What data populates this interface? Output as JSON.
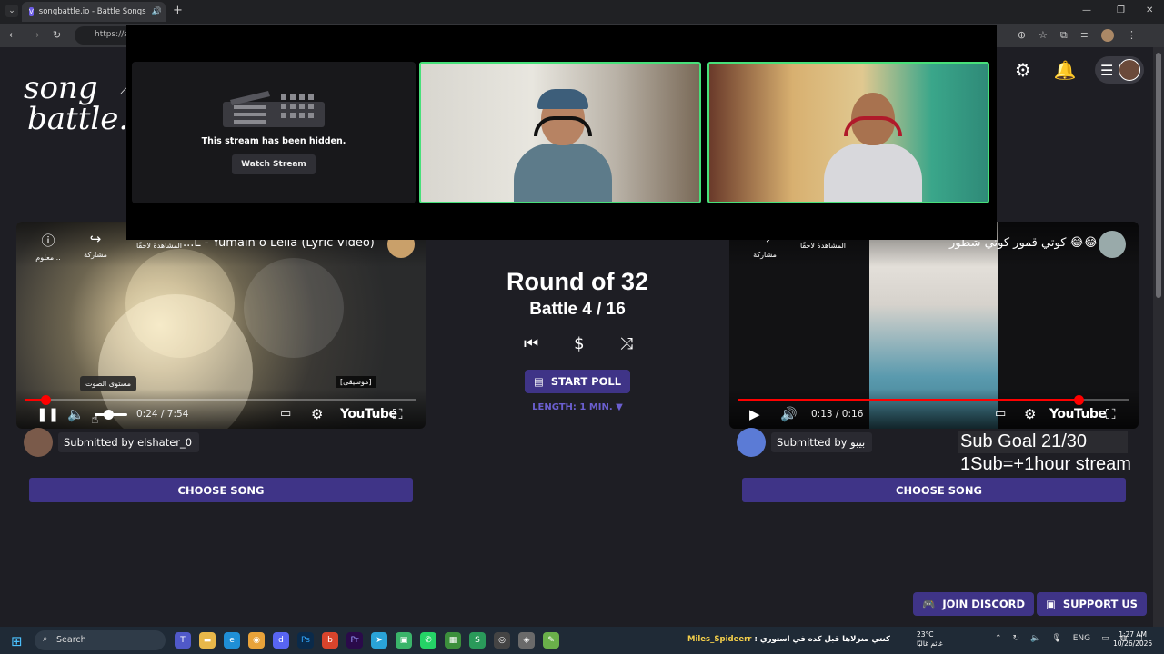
{
  "browser": {
    "tab_title": "songbattle.io - Battle Songs",
    "url": "https://s",
    "tab_favicon": "V"
  },
  "site": {
    "logo_line1": "song",
    "logo_line2": "battle.i"
  },
  "overlay": {
    "hidden_text": "This stream has been hidden.",
    "watch_button": "Watch Stream"
  },
  "left_player": {
    "title": "...L - Yumain o Leila (Lyric Video)",
    "info_label": "معلوم...",
    "share_label": "مشاركة",
    "watch_later_label": "المشاهدة لاحقًا",
    "tooltip": "مستوى الصوت",
    "music_tag": "[موسيقى]",
    "time": "0:24 / 7:54",
    "progress": 0.05,
    "youtube_label": "YouTube"
  },
  "right_player": {
    "title": "كوتي قمور كوتي شطور 😂😂",
    "share_label": "مشاركة",
    "watch_later_label": "المشاهدة لاحقًا",
    "time": "0:13 / 0:16",
    "progress": 0.87,
    "youtube_label": "YouTube"
  },
  "center": {
    "round": "Round of 32",
    "battle": "Battle 4 / 16",
    "start_poll": "START POLL",
    "length": "LENGTH: 1 MIN. ▼"
  },
  "submitters": {
    "left": "Submitted by elshater_0",
    "right": "Submitted by بيبو"
  },
  "buttons": {
    "choose_left": "CHOOSE SONG",
    "choose_right": "CHOOSE SONG",
    "join_discord": "JOIN DISCORD",
    "support_us": "SUPPORT US"
  },
  "stream_overlay_text": {
    "sub_goal": "Sub Goal 21/30",
    "sub_rule": "1Sub=+1hour stream"
  },
  "taskbar": {
    "search": "Search",
    "ticker_name": "Miles_Spideerr",
    "ticker_text": " : كنتي منزلاها قبل كده في استوري",
    "weather_temp": "23°C",
    "weather_desc": "غائم غالبًا",
    "lang": "ENG",
    "time": "1:27 AM",
    "date": "10/26/2025"
  },
  "colors": {
    "accent": "#3f3487",
    "cam_border": "#47e07a",
    "progress": "#ff0000"
  }
}
